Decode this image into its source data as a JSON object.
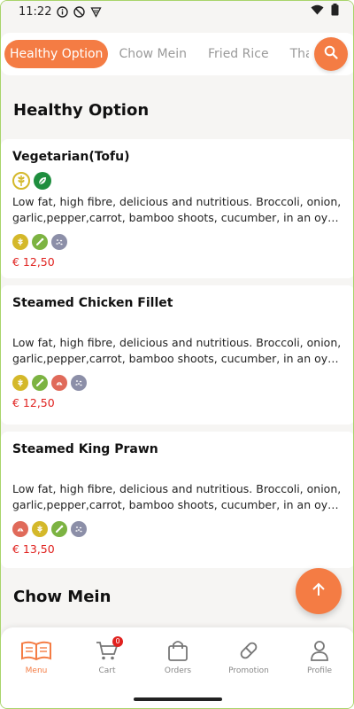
{
  "status_bar": {
    "time": "11:22",
    "icons": [
      "info-icon",
      "no-disturb-icon",
      "vpn-icon",
      "wifi-icon",
      "battery-icon"
    ]
  },
  "categories": [
    {
      "label": "Healthy Option",
      "active": true
    },
    {
      "label": "Chow Mein",
      "active": false
    },
    {
      "label": "Fried Rice",
      "active": false
    },
    {
      "label": "Thai",
      "active": false
    }
  ],
  "sections": [
    {
      "title": "Healthy Option",
      "items": [
        {
          "name": "Vegetarian(Tofu)",
          "badges": [
            "wheat-icon",
            "leaf-icon"
          ],
          "desc_line1": "Low fat, high fibre, delicious and nutritious. Broccoli, onion,",
          "desc_line2": "garlic,pepper,carrot, bamboo shoots, cucumber, in an oyster sa...",
          "allergens": [
            "gluten-icon",
            "celery-icon",
            "sesame-icon"
          ],
          "price": "€ 12,50"
        },
        {
          "name": "Steamed Chicken Fillet",
          "badges": [],
          "desc_line1": "Low fat, high fibre, delicious and nutritious. Broccoli, onion,",
          "desc_line2": "garlic,pepper,carrot, bamboo shoots, cucumber, in an oyster sa...",
          "allergens": [
            "gluten-icon",
            "celery-icon",
            "shellfish-icon",
            "sesame-icon"
          ],
          "price": "€ 12,50"
        },
        {
          "name": "Steamed King Prawn",
          "badges": [],
          "desc_line1": "Low fat, high fibre, delicious and nutritious. Broccoli, onion,",
          "desc_line2": "garlic,pepper,carrot, bamboo shoots, cucumber, in an oyster sa...",
          "allergens": [
            "shellfish-icon",
            "gluten-icon",
            "celery-icon",
            "sesame-icon"
          ],
          "price": "€ 13,50"
        }
      ]
    },
    {
      "title": "Chow Mein",
      "items": []
    }
  ],
  "bottom_nav": [
    {
      "label": "Menu",
      "icon": "menu-book-icon",
      "active": true
    },
    {
      "label": "Cart",
      "icon": "cart-icon",
      "active": false,
      "count": "0"
    },
    {
      "label": "Orders",
      "icon": "bag-icon",
      "active": false
    },
    {
      "label": "Promotion",
      "icon": "pill-icon",
      "active": false
    },
    {
      "label": "Profile",
      "icon": "profile-icon",
      "active": false
    }
  ],
  "colors": {
    "accent": "#f47c44",
    "price": "#e0211e",
    "gluten": "#d4b82a",
    "celery": "#7cb342",
    "shellfish": "#e06a5a",
    "sesame": "#8c8fa8",
    "leaf_badge": "#1e8e3e"
  }
}
